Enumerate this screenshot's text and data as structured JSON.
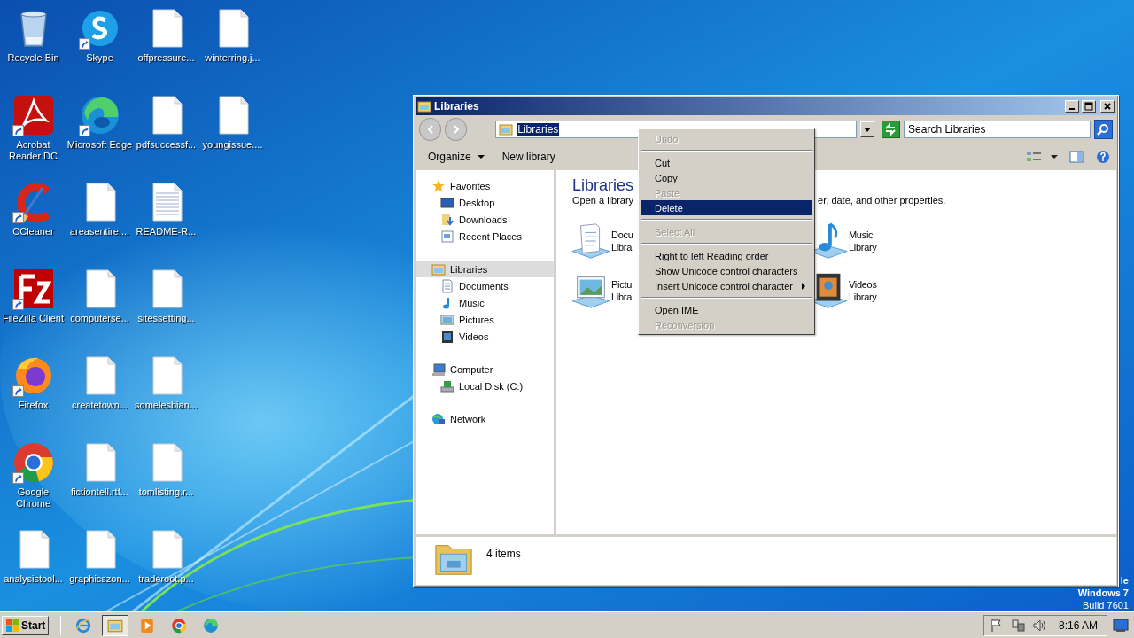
{
  "desktop": {
    "columns": [
      [
        {
          "label": "Recycle Bin",
          "kind": "recycle",
          "shortcut": false
        },
        {
          "label": "Acrobat Reader DC",
          "kind": "acrobat",
          "shortcut": true
        },
        {
          "label": "CCleaner",
          "kind": "ccleaner",
          "shortcut": true
        },
        {
          "label": "FileZilla Client",
          "kind": "filezilla",
          "shortcut": true
        },
        {
          "label": "Firefox",
          "kind": "firefox",
          "shortcut": true
        },
        {
          "label": "Google Chrome",
          "kind": "chrome",
          "shortcut": true
        },
        {
          "label": "analysistool...",
          "kind": "file",
          "shortcut": false
        }
      ],
      [
        {
          "label": "Skype",
          "kind": "skype",
          "shortcut": true
        },
        {
          "label": "Microsoft Edge",
          "kind": "edge",
          "shortcut": true
        },
        {
          "label": "areasentire....",
          "kind": "file",
          "shortcut": false
        },
        {
          "label": "computerse...",
          "kind": "file",
          "shortcut": false
        },
        {
          "label": "createtown...",
          "kind": "file",
          "shortcut": false
        },
        {
          "label": "fictiontell.rtf...",
          "kind": "file",
          "shortcut": false
        },
        {
          "label": "graphicszon...",
          "kind": "file",
          "shortcut": false
        }
      ],
      [
        {
          "label": "offpressure...",
          "kind": "file",
          "shortcut": false
        },
        {
          "label": "pdfsuccessf...",
          "kind": "file",
          "shortcut": false
        },
        {
          "label": "README-R...",
          "kind": "text",
          "shortcut": false
        },
        {
          "label": "sitessetting...",
          "kind": "file",
          "shortcut": false
        },
        {
          "label": "somelesbian...",
          "kind": "file",
          "shortcut": false
        },
        {
          "label": "tomlisting.r...",
          "kind": "file",
          "shortcut": false
        },
        {
          "label": "traderoot.p...",
          "kind": "file",
          "shortcut": false
        }
      ],
      [
        {
          "label": "winterring.j...",
          "kind": "file",
          "shortcut": false
        },
        {
          "label": "youngissue....",
          "kind": "file",
          "shortcut": false
        }
      ]
    ]
  },
  "window": {
    "title": "Libraries",
    "address": "Libraries",
    "address_text_selected": true,
    "search_placeholder": "Search Libraries",
    "organize": "Organize",
    "new_library": "New library",
    "nav": [
      {
        "label": "Favorites",
        "kind": "star",
        "selected": false,
        "children": [
          {
            "label": "Desktop",
            "kind": "desktop",
            "selected": false
          },
          {
            "label": "Downloads",
            "kind": "downloads",
            "selected": false
          },
          {
            "label": "Recent Places",
            "kind": "recent",
            "selected": false
          }
        ]
      },
      {
        "label": "Libraries",
        "kind": "libraries",
        "selected": true,
        "children": [
          {
            "label": "Documents",
            "kind": "documents",
            "selected": false
          },
          {
            "label": "Music",
            "kind": "music",
            "selected": false
          },
          {
            "label": "Pictures",
            "kind": "pictures",
            "selected": false
          },
          {
            "label": "Videos",
            "kind": "videos",
            "selected": false
          }
        ]
      },
      {
        "label": "Computer",
        "kind": "computer",
        "selected": false,
        "children": [
          {
            "label": "Local Disk (C:)",
            "kind": "disk",
            "selected": false
          }
        ]
      },
      {
        "label": "Network",
        "kind": "network",
        "selected": false
      }
    ],
    "heading": "Libraries",
    "subtitle_left": "Open a library",
    "subtitle_right": "er, date, and other properties.",
    "libraries": [
      {
        "name": "Docu",
        "sub": "Libra",
        "kind": "documents"
      },
      {
        "name": "Music",
        "sub": "Library",
        "kind": "music"
      },
      {
        "name": "Pictu",
        "sub": "Libra",
        "kind": "pictures"
      },
      {
        "name": "Videos",
        "sub": "Library",
        "kind": "videos"
      }
    ],
    "status": "4 items"
  },
  "context_menu": [
    {
      "kind": "item",
      "label": "Undo",
      "disabled": true,
      "highlighted": false
    },
    {
      "kind": "separator"
    },
    {
      "kind": "item",
      "label": "Cut",
      "disabled": false,
      "highlighted": false
    },
    {
      "kind": "item",
      "label": "Copy",
      "disabled": false,
      "highlighted": false
    },
    {
      "kind": "item",
      "label": "Paste",
      "disabled": true,
      "highlighted": false
    },
    {
      "kind": "item",
      "label": "Delete",
      "disabled": false,
      "highlighted": true
    },
    {
      "kind": "separator"
    },
    {
      "kind": "item",
      "label": "Select All",
      "disabled": true,
      "highlighted": false
    },
    {
      "kind": "separator"
    },
    {
      "kind": "item",
      "label": "Right to left Reading order",
      "disabled": false,
      "highlighted": false
    },
    {
      "kind": "item",
      "label": "Show Unicode control characters",
      "disabled": false,
      "highlighted": false
    },
    {
      "kind": "submenu",
      "label": "Insert Unicode control character",
      "disabled": false,
      "highlighted": false
    },
    {
      "kind": "separator"
    },
    {
      "kind": "item",
      "label": "Open IME",
      "disabled": false,
      "highlighted": false
    },
    {
      "kind": "item",
      "label": "Reconversion",
      "disabled": true,
      "highlighted": false
    }
  ],
  "branding": [
    "le",
    "Windows 7",
    "Build 7601"
  ],
  "taskbar": {
    "start": "Start",
    "apps": [
      {
        "kind": "ie",
        "active": false
      },
      {
        "kind": "explorer",
        "active": true
      },
      {
        "kind": "media",
        "active": false
      },
      {
        "kind": "chrome",
        "active": false
      },
      {
        "kind": "edge",
        "active": false
      }
    ],
    "clock": "8:16 AM"
  }
}
